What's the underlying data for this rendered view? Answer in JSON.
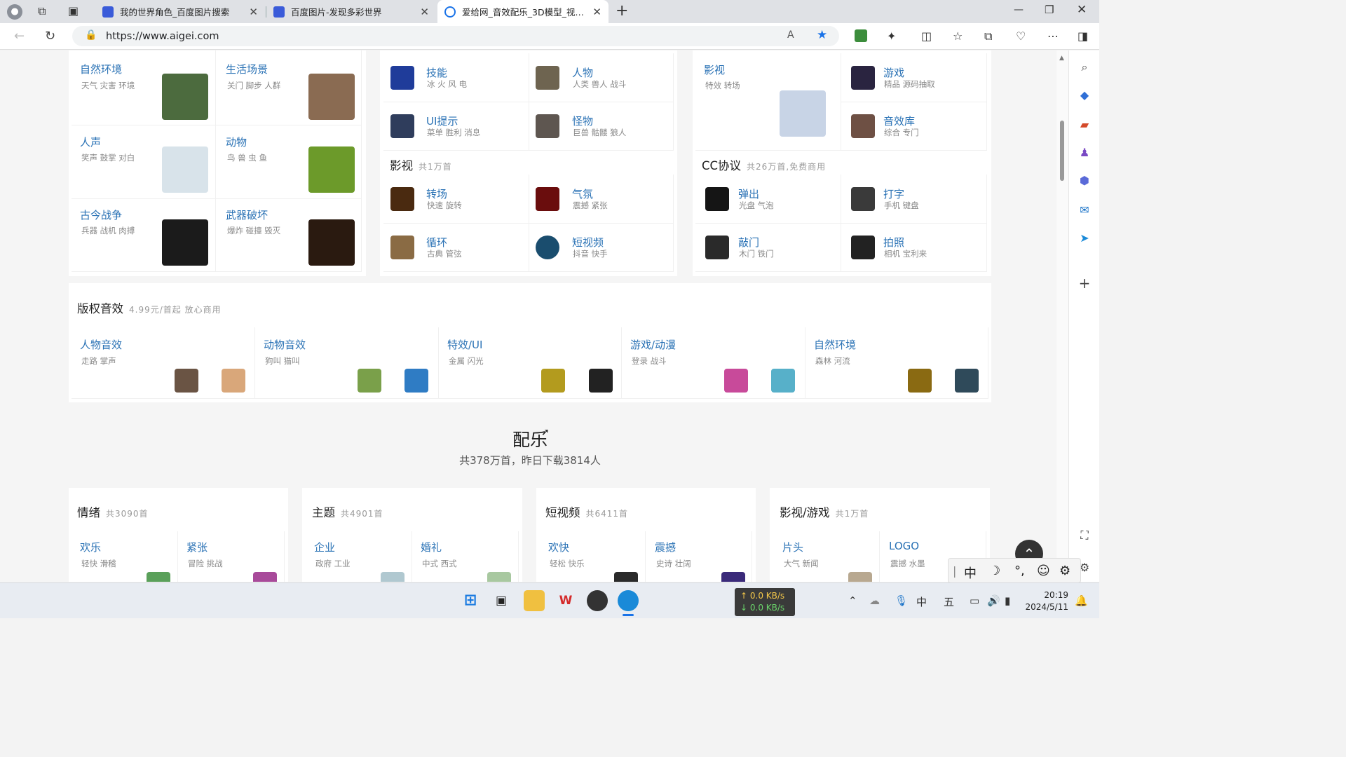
{
  "browser": {
    "tabs": [
      {
        "title": "我的世界角色_百度图片搜索",
        "active": false
      },
      {
        "title": "百度图片-发现多彩世界",
        "active": false
      },
      {
        "title": "爱给网_音效配乐_3D模型_视频素",
        "active": true
      }
    ],
    "new_tab": "+",
    "url": "https://www.aigei.com"
  },
  "col1": [
    {
      "title": "自然环境",
      "sub": "天气 灾害 环境",
      "color": "#4c6b3e"
    },
    {
      "title": "生活场景",
      "sub": "关门 脚步 人群",
      "color": "#8a6b52"
    },
    {
      "title": "人声",
      "sub": "笑声 鼓掌 对白",
      "color": "#d8e3ea"
    },
    {
      "title": "动物",
      "sub": "鸟 兽 虫 鱼",
      "color": "#6c9a2a"
    },
    {
      "title": "古今战争",
      "sub": "兵器 战机 肉搏",
      "color": "#1b1b1b"
    },
    {
      "title": "武器破坏",
      "sub": "爆炸 碰撞 毁灭",
      "color": "#2a1a10"
    }
  ],
  "col2_top": [
    {
      "title": "技能",
      "sub": "冰 火 风 电",
      "color": "#1f3c9a"
    },
    {
      "title": "人物",
      "sub": "人类 兽人 战斗",
      "color": "#6e6450"
    },
    {
      "title": "UI提示",
      "sub": "菜单 胜利 消息",
      "color": "#2f3d5c"
    },
    {
      "title": "怪物",
      "sub": "巨兽 骷髅 狼人",
      "color": "#5e5650"
    }
  ],
  "film": {
    "title": "影视",
    "sub": "共1万首"
  },
  "col2_bottom": [
    {
      "title": "转场",
      "sub": "快速 旋转",
      "color": "#4a2a10"
    },
    {
      "title": "气氛",
      "sub": "震撼 紧张",
      "color": "#6a0d0d"
    },
    {
      "title": "循环",
      "sub": "古典 管弦",
      "color": "#8a6b44"
    },
    {
      "title": "短视频",
      "sub": "抖音 快手",
      "color": "#1a4d6e"
    }
  ],
  "col3_video": {
    "title": "影视",
    "sub": "特效 转场",
    "color": "#c8d4e6"
  },
  "col3_top": [
    {
      "title": "游戏",
      "sub": "精品 源码抽取",
      "color": "#2a2440"
    },
    {
      "title": "音效库",
      "sub": "综合 专门",
      "color": "#6e5044"
    }
  ],
  "cc": {
    "title": "CC协议",
    "sub": "共26万首,免费商用"
  },
  "col3_bottom": [
    {
      "title": "弹出",
      "sub": "光盘 气泡",
      "color": "#151515"
    },
    {
      "title": "打字",
      "sub": "手机 键盘",
      "color": "#3a3a3a"
    },
    {
      "title": "敲门",
      "sub": "木门 铁门",
      "color": "#2a2a2a"
    },
    {
      "title": "拍照",
      "sub": "相机 宝利来",
      "color": "#222222"
    }
  ],
  "copyright": {
    "title": "版权音效",
    "sub": "4.99元/首起 放心商用"
  },
  "copyright_items": [
    {
      "title": "人物音效",
      "sub": "走路 掌声",
      "c1": "#6a5444",
      "c2": "#d9a77a"
    },
    {
      "title": "动物音效",
      "sub": "狗叫 猫叫",
      "c1": "#7aa04a",
      "c2": "#2f7cc4"
    },
    {
      "title": "特效/UI",
      "sub": "金属 闪光",
      "c1": "#b39b1e",
      "c2": "#222222"
    },
    {
      "title": "游戏/动漫",
      "sub": "登录 战斗",
      "c1": "#c84a9a",
      "c2": "#57b0c9"
    },
    {
      "title": "自然环境",
      "sub": "森林 河流",
      "c1": "#8a6a12",
      "c2": "#2f4a5a"
    }
  ],
  "music": {
    "title": "配乐",
    "subtitle": "共378万首，昨日下载3814人"
  },
  "music_cards": [
    {
      "title": "情绪",
      "sub": "共3090首",
      "items": [
        {
          "title": "欢乐",
          "sub": "轻快 滑稽"
        },
        {
          "title": "紧张",
          "sub": "冒险 挑战"
        }
      ]
    },
    {
      "title": "主题",
      "sub": "共4901首",
      "items": [
        {
          "title": "企业",
          "sub": "政府 工业"
        },
        {
          "title": "婚礼",
          "sub": "中式 西式"
        }
      ]
    },
    {
      "title": "短视频",
      "sub": "共6411首",
      "items": [
        {
          "title": "欢快",
          "sub": "轻松 快乐"
        },
        {
          "title": "震撼",
          "sub": "史诗 壮阔"
        }
      ]
    },
    {
      "title": "影视/游戏",
      "sub": "共1万首",
      "items": [
        {
          "title": "片头",
          "sub": "大气 新闻"
        },
        {
          "title": "LOGO",
          "sub": "震撼 水墨"
        }
      ]
    }
  ],
  "ime": {
    "lang": "中",
    "punct": "°,"
  },
  "taskbar": {
    "net_up": "↑ 0.0 KB/s",
    "net_down": "↓ 0.0 KB/s",
    "ime_lang": "中",
    "ime_mode": "五",
    "time": "20:19",
    "date": "2024/5/11"
  }
}
